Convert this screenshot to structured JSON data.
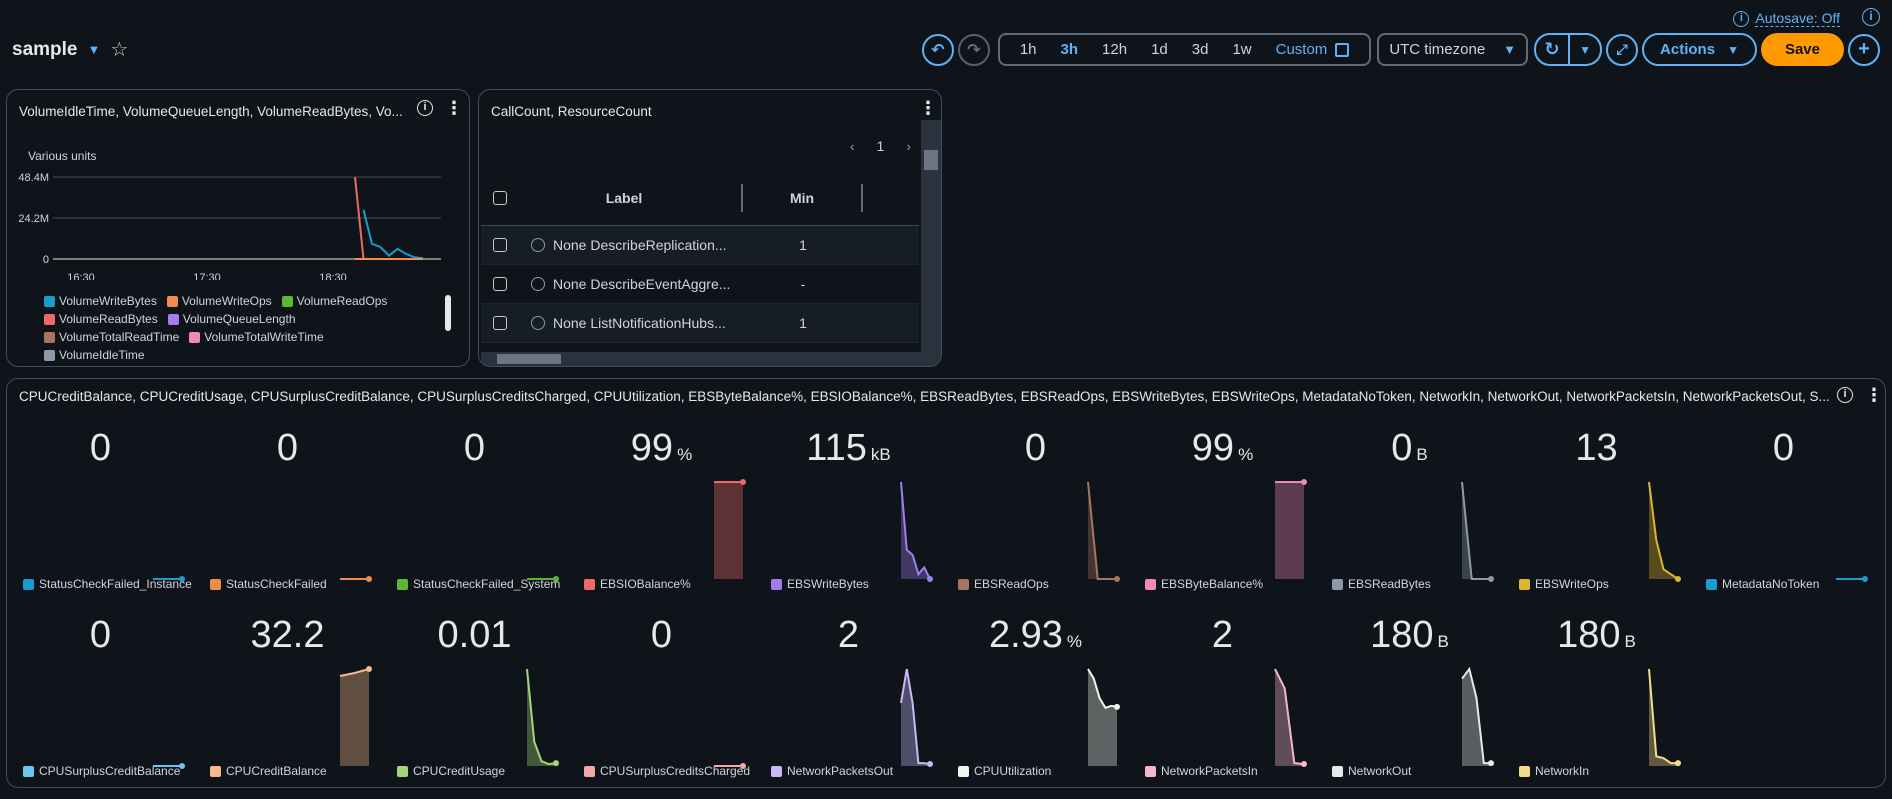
{
  "header": {
    "dashboard_name": "sample",
    "autosave": "Autosave: Off",
    "time_ranges": [
      "1h",
      "3h",
      "12h",
      "1d",
      "3d",
      "1w"
    ],
    "active_range": "3h",
    "custom_label": "Custom",
    "timezone": "UTC timezone",
    "actions_label": "Actions",
    "save_label": "Save"
  },
  "widget1": {
    "title": "VolumeIdleTime, VolumeQueueLength, VolumeReadBytes, Vo...",
    "unit_label": "Various units",
    "chart_data": {
      "type": "line",
      "x_ticks": [
        "16:30",
        "17:30",
        "18:30"
      ],
      "y_ticks": [
        "48.4M",
        "24.2M",
        "0"
      ],
      "ylim": [
        0,
        48400000
      ],
      "x": [
        "18:38",
        "18:43",
        "18:48",
        "18:53",
        "18:58",
        "19:03",
        "19:08",
        "19:13",
        "19:18"
      ],
      "series": [
        {
          "name": "VolumeWriteBytes",
          "color": "#1a9ccf",
          "values": [
            null,
            29000000,
            9000000,
            7000000,
            2000000,
            6000000,
            3000000,
            1000000,
            500000
          ]
        },
        {
          "name": "VolumeReadBytes",
          "color": "#ee6a6a",
          "values": [
            48400000,
            0,
            0,
            0,
            0,
            0,
            0,
            0,
            0
          ]
        },
        {
          "name": "VolumeWriteOps",
          "color": "#f28b4c",
          "values": [
            0,
            0,
            0,
            0,
            0,
            0,
            0,
            0,
            0
          ]
        }
      ]
    },
    "legend": [
      [
        {
          "name": "VolumeWriteBytes",
          "color": "#1a9ccf"
        },
        {
          "name": "VolumeWriteOps",
          "color": "#f28b4c"
        },
        {
          "name": "VolumeReadOps",
          "color": "#5cb82e"
        }
      ],
      [
        {
          "name": "VolumeReadBytes",
          "color": "#ee6a6a"
        },
        {
          "name": "VolumeQueueLength",
          "color": "#a07ef2"
        }
      ],
      [
        {
          "name": "VolumeTotalReadTime",
          "color": "#a87361"
        },
        {
          "name": "VolumeTotalWriteTime",
          "color": "#f288b4"
        }
      ],
      [
        {
          "name": "VolumeIdleTime",
          "color": "#8d99a8"
        }
      ]
    ]
  },
  "widget2": {
    "title": "CallCount, ResourceCount",
    "page": "1",
    "columns": [
      "Label",
      "Min"
    ],
    "rows": [
      {
        "label": "None DescribeReplication...",
        "min": "1"
      },
      {
        "label": "None DescribeEventAggre...",
        "min": "-"
      },
      {
        "label": "None ListNotificationHubs...",
        "min": "1"
      }
    ]
  },
  "widget3": {
    "title": "CPUCreditBalance, CPUCreditUsage, CPUSurplusCreditBalance, CPUSurplusCreditsCharged, CPUUtilization, EBSByteBalance%, EBSIOBalance%, EBSReadBytes, EBSReadOps, EBSWriteBytes, EBSWriteOps, MetadataNoToken, NetworkIn, NetworkOut, NetworkPacketsIn, NetworkPacketsOut, S...",
    "cells": [
      {
        "value": "0",
        "unit": "",
        "label": "StatusCheckFailed_Instance",
        "color": "#1a9ccf",
        "spark": [
          0,
          0,
          0
        ],
        "fill": false
      },
      {
        "value": "0",
        "unit": "",
        "label": "StatusCheckFailed",
        "color": "#f28b4c",
        "spark": [
          0,
          0,
          0
        ],
        "fill": false
      },
      {
        "value": "0",
        "unit": "",
        "label": "StatusCheckFailed_System",
        "color": "#5cb82e",
        "spark": [
          0,
          0,
          0
        ],
        "fill": false
      },
      {
        "value": "99",
        "unit": "%",
        "label": "EBSIOBalance%",
        "color": "#ee6a6a",
        "spark": [
          99,
          99,
          99
        ],
        "fill": true
      },
      {
        "value": "115",
        "unit": "kB",
        "label": "EBSWriteBytes",
        "color": "#a07ef2",
        "spark": [
          100,
          30,
          25,
          5,
          12,
          0
        ],
        "fill": true
      },
      {
        "value": "0",
        "unit": "",
        "label": "EBSReadOps",
        "color": "#a87361",
        "spark": [
          100,
          0,
          0,
          0
        ],
        "fill": true
      },
      {
        "value": "99",
        "unit": "%",
        "label": "EBSByteBalance%",
        "color": "#f288b4",
        "spark": [
          99,
          99,
          99
        ],
        "fill": true
      },
      {
        "value": "0",
        "unit": "B",
        "label": "EBSReadBytes",
        "color": "#8d99a8",
        "spark": [
          100,
          0,
          0,
          0
        ],
        "fill": true
      },
      {
        "value": "13",
        "unit": "",
        "label": "EBSWriteOps",
        "color": "#dfb52c",
        "spark": [
          100,
          40,
          10,
          5,
          0
        ],
        "fill": true
      },
      {
        "value": "0",
        "unit": "",
        "label": "MetadataNoToken",
        "color": "#1a9ccf",
        "spark": [
          0,
          0,
          0
        ],
        "fill": false
      },
      {
        "value": "0",
        "unit": "",
        "label": "CPUSurplusCreditBalance",
        "color": "#6bc6ef",
        "spark": [
          0,
          0,
          0
        ],
        "fill": false
      },
      {
        "value": "32.2",
        "unit": "",
        "label": "CPUCreditBalance",
        "color": "#f8b98c",
        "spark": [
          90,
          93,
          97
        ],
        "fill": true
      },
      {
        "value": "0.01",
        "unit": "",
        "label": "CPUCreditUsage",
        "color": "#a3d67c",
        "spark": [
          100,
          25,
          5,
          2,
          3
        ],
        "fill": true
      },
      {
        "value": "0",
        "unit": "",
        "label": "CPUSurplusCreditsCharged",
        "color": "#f7a6a6",
        "spark": [
          0,
          0,
          0
        ],
        "fill": false
      },
      {
        "value": "2",
        "unit": "",
        "label": "NetworkPacketsOut",
        "color": "#c9b8f8",
        "spark": [
          65,
          100,
          65,
          3,
          3,
          2
        ],
        "fill": true
      },
      {
        "value": "2.93",
        "unit": "%",
        "label": "CPUUtilization",
        "color": "#f5f3ef",
        "spark": [
          100,
          90,
          70,
          60,
          62,
          61
        ],
        "fill": true
      },
      {
        "value": "2",
        "unit": "",
        "label": "NetworkPacketsIn",
        "color": "#f7b6cf",
        "spark": [
          100,
          80,
          3,
          2
        ],
        "fill": true
      },
      {
        "value": "180",
        "unit": "B",
        "label": "NetworkOut",
        "color": "#e6e8ea",
        "spark": [
          90,
          100,
          70,
          3,
          3
        ],
        "fill": true
      },
      {
        "value": "180",
        "unit": "B",
        "label": "NetworkIn",
        "color": "#f6dc8a",
        "spark": [
          100,
          10,
          8,
          3,
          3
        ],
        "fill": true
      }
    ]
  }
}
